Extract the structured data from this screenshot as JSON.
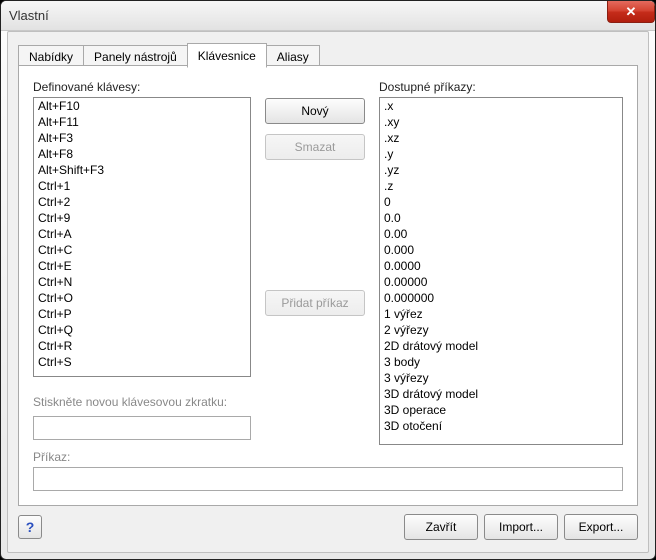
{
  "window": {
    "title": "Vlastní"
  },
  "tabs": {
    "items": [
      {
        "label": "Nabídky"
      },
      {
        "label": "Panely nástrojů"
      },
      {
        "label": "Klávesnice"
      },
      {
        "label": "Aliasy"
      }
    ]
  },
  "labels": {
    "defined_keys": "Definované klávesy:",
    "available_commands": "Dostupné příkazy:",
    "press_shortcut": "Stiskněte novou klávesovou zkratku:",
    "command": "Příkaz:"
  },
  "buttons": {
    "new": "Nový",
    "delete": "Smazat",
    "add_cmd": "Přidat příkaz",
    "close": "Zavřít",
    "import": "Import...",
    "export": "Export...",
    "help": "?"
  },
  "defined_keys": [
    "Alt+F10",
    "Alt+F11",
    "Alt+F3",
    "Alt+F8",
    "Alt+Shift+F3",
    "Ctrl+1",
    "Ctrl+2",
    "Ctrl+9",
    "Ctrl+A",
    "Ctrl+C",
    "Ctrl+E",
    "Ctrl+N",
    "Ctrl+O",
    "Ctrl+P",
    "Ctrl+Q",
    "Ctrl+R",
    "Ctrl+S"
  ],
  "available_commands": [
    ".x",
    ".xy",
    ".xz",
    ".y",
    ".yz",
    ".z",
    "0",
    "0.0",
    "0.00",
    "0.000",
    "0.0000",
    "0.00000",
    "0.000000",
    "1 výřez",
    "2 výřezy",
    "2D drátový model",
    "3 body",
    "3 výřezy",
    "3D drátový model",
    "3D operace",
    "3D otočení"
  ],
  "inputs": {
    "shortcut_value": "",
    "command_value": ""
  }
}
